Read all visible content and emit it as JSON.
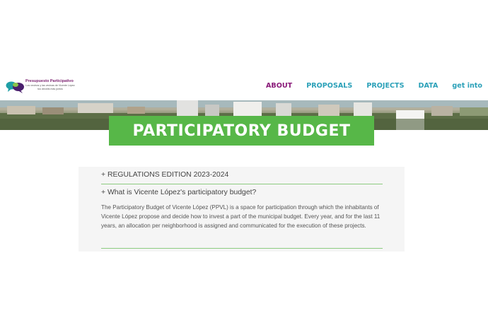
{
  "header": {
    "logo_title": "Presupuesto Participativo",
    "logo_subtitle_1": "Los vecinos y las vecinas de Vicente López",
    "logo_subtitle_2": "tus decidís más juntos",
    "nav": [
      {
        "label": "ABOUT",
        "active": true
      },
      {
        "label": "PROPOSALS",
        "active": false
      },
      {
        "label": "PROJECTS",
        "active": false
      },
      {
        "label": "DATA",
        "active": false
      },
      {
        "label": "get into",
        "active": false
      }
    ]
  },
  "hero": {
    "title": "PARTICIPATORY BUDGET"
  },
  "accordion": {
    "item1": "+ REGULATIONS EDITION 2023-2024",
    "item2": "+ What is Vicente López's participatory budget?",
    "item2_body": "The Participatory Budget of Vicente López (PPVL) is a space for participation through which the inhabitants of Vicente López propose and decide how to invest a part of the municipal budget. Every year, and for the last 11 years, an allocation per neighborhood is assigned and communicated for the execution of these projects."
  },
  "colors": {
    "accent_green": "#57b748",
    "nav_teal": "#2aa0b8",
    "nav_active_purple": "#8a1a79"
  }
}
